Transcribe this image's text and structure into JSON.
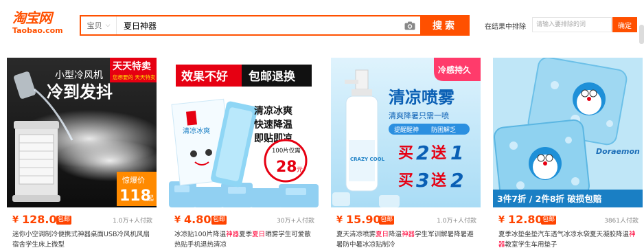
{
  "header": {
    "logo_cn": "淘宝网",
    "logo_en": "Taobao.com",
    "scope_label": "宝贝",
    "query": "夏日神器",
    "search_button": "搜索",
    "filter_label": "在结果中排除",
    "filter_placeholder": "请输入要排除的词",
    "filter_button": "确定"
  },
  "colors": {
    "brand": "#ff5000",
    "price": "#ff4400",
    "highlight": "#ff0036"
  },
  "items": [
    {
      "yen": "¥",
      "price": "128.00",
      "badge": "包邮",
      "sold": "1.0万+人付款",
      "title_pre": "迷你小空调制冷便携式神器桌面USB冷风机风扇宿舍学生床上微型",
      "title_hl": "",
      "title_post": "",
      "img": {
        "line1": "小型冷风机",
        "line2": "冷到发抖",
        "tag1": "天天特卖",
        "tag2": "您想要的 天天特卖",
        "promo": "惊爆价",
        "promo_price": "118",
        "promo_unit": "起"
      }
    },
    {
      "yen": "¥",
      "price": "4.80",
      "badge": "包邮",
      "sold": "30万+人付款",
      "title_pre": "冰凉贴100片降温",
      "title_hl": "神器",
      "title_post": "夏季",
      "title_hl2": "夏日",
      "title_post2": "晒雾学生可爱散热贴手机退热清凉",
      "img": {
        "banner_left": "效果不好",
        "banner_right": "包邮退换",
        "pkg_text": "清凉冰爽",
        "line1": "清凉冰爽",
        "line2": "快速降温",
        "line3": "即贴即凉",
        "circle_top": "100片仅需",
        "circle_price": "28",
        "circle_unit": "元"
      }
    },
    {
      "yen": "¥",
      "price": "15.90",
      "badge": "包邮",
      "sold": "1.0万+人付款",
      "title_pre": "夏天清凉喷雾",
      "title_hl": "夏日",
      "title_post": "降温",
      "title_hl2": "神器",
      "title_post2": "学生军训解暑降暑避暑防中暑冰凉贴制冷",
      "img": {
        "corner": "冷感持久",
        "headline": "清凉喷雾",
        "sub": "清爽降暑只需一喷",
        "chip1": "提醒醒神",
        "chip2": "防困解乏",
        "buy1": "买",
        "n1": "2",
        "send1": "送",
        "m1": "1",
        "buy2": "买",
        "n2": "3",
        "send2": "送",
        "m2": "2",
        "bottle": "CRAZY COOL"
      }
    },
    {
      "yen": "¥",
      "price": "12.80",
      "badge": "包邮",
      "sold": "3861人付款",
      "title_pre": "夏季冰垫坐垫汽车透气冰凉水袋夏天凝胶降温",
      "title_hl": "神器",
      "title_post": "教室学生车用垫子",
      "img": {
        "brand": "Doraemon",
        "promo": "3件7折 / 2件8折 破损包赔"
      }
    }
  ]
}
